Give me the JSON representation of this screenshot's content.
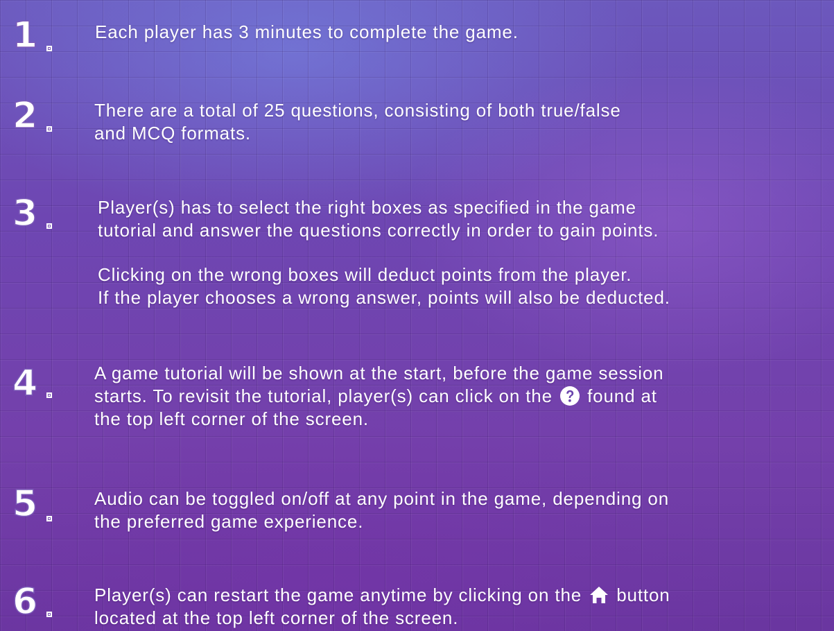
{
  "rules": [
    {
      "number": "1",
      "lines": [
        "Each player has 3 minutes to complete the game."
      ]
    },
    {
      "number": "2",
      "lines": [
        "There are a total of 25 questions, consisting of both true/false",
        "and MCQ formats."
      ]
    },
    {
      "number": "3",
      "lines": [
        "Player(s) has to select the right boxes as specified in the game",
        "tutorial and answer the questions correctly in order to gain points."
      ],
      "extra_lines": [
        "Clicking on the wrong boxes will deduct points from the player.",
        "If the player chooses a wrong answer, points will also be deducted."
      ]
    },
    {
      "number": "4",
      "line1": "A game tutorial will be shown at the start, before the game session",
      "line2_before": "starts. To revisit the tutorial, player(s) can click on the",
      "line2_icon": "help-question-icon",
      "line2_after": "found at",
      "line3": "the top left corner of the screen."
    },
    {
      "number": "5",
      "lines": [
        "Audio can be toggled on/off at any point in the game, depending on",
        "the preferred game experience."
      ]
    },
    {
      "number": "6",
      "line1_before": "Player(s) can restart the game anytime by clicking on the",
      "line1_icon": "home-icon",
      "line1_after": "button",
      "line2": "located at the top left corner of the screen."
    }
  ],
  "colors": {
    "text": "#ffffff",
    "background": "#6e46b2",
    "numeral_outline": "#7b5bb8"
  }
}
